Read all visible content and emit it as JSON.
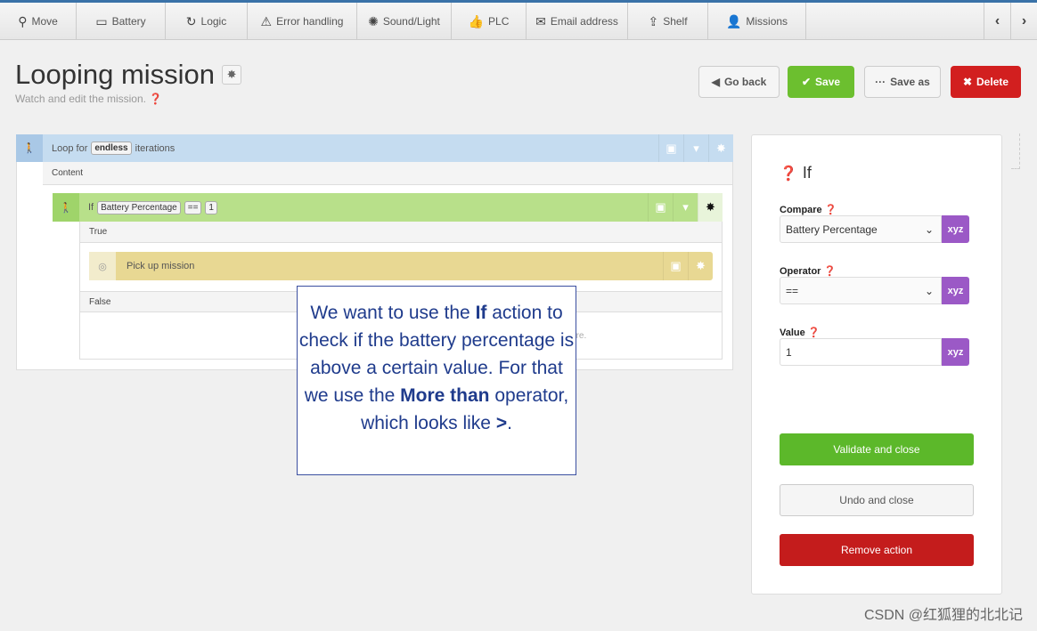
{
  "tabs": [
    {
      "label": "Move",
      "icon": "map-pin-icon",
      "glyph": "⚲",
      "w": 86
    },
    {
      "label": "Battery",
      "icon": "battery-icon",
      "glyph": "▭",
      "w": 100
    },
    {
      "label": "Logic",
      "icon": "loop-icon",
      "glyph": "↻",
      "w": 92
    },
    {
      "label": "Error handling",
      "icon": "warning-icon",
      "glyph": "⚠",
      "w": 123
    },
    {
      "label": "Sound/Light",
      "icon": "bulb-icon",
      "glyph": "✺",
      "w": 106
    },
    {
      "label": "PLC",
      "icon": "thumbs-up-icon",
      "glyph": "👍",
      "w": 84
    },
    {
      "label": "Email address",
      "icon": "envelope-icon",
      "glyph": "✉",
      "w": 114
    },
    {
      "label": "Shelf",
      "icon": "upload-icon",
      "glyph": "⇪",
      "w": 90
    },
    {
      "label": "Missions",
      "icon": "user-icon",
      "glyph": "👤",
      "w": 110
    }
  ],
  "header": {
    "title": "Looping mission",
    "subtitle": "Watch and edit the mission."
  },
  "actions": {
    "go_back": "Go back",
    "save": "Save",
    "save_as": "Save as",
    "delete": "Delete"
  },
  "loop": {
    "prefix": "Loop for",
    "count": "endless",
    "suffix": "iterations",
    "content_label": "Content"
  },
  "if_block": {
    "prefix": "If",
    "compare": "Battery Percentage",
    "operator": "==",
    "value": "1",
    "true_label": "True",
    "false_label": "False",
    "drop_hint": "actions here."
  },
  "pickup": {
    "label": "Pick up mission"
  },
  "panel": {
    "title": "If",
    "compare_label": "Compare",
    "compare_value": "Battery Percentage",
    "operator_label": "Operator",
    "operator_value": "==",
    "value_label": "Value",
    "value_value": "1",
    "variable_glyph": "xyz",
    "validate": "Validate and close",
    "undo": "Undo and close",
    "remove": "Remove action"
  },
  "callout": {
    "t1": "We want to use the ",
    "b1": "If",
    "t2": " action to check if the battery percentage is above a certain value. For that we use the ",
    "b2": "More than",
    "t3": " operator, which looks like ",
    "b3": ">",
    "t4": "."
  },
  "watermark": "CSDN @红狐狸的北北记",
  "colors": {
    "loop": "#c5dcf0",
    "if": "#b8e08a",
    "pickup": "#e8d893",
    "save": "#6cbf2f",
    "delete": "#d21f1f",
    "variable": "#9b59c6"
  }
}
